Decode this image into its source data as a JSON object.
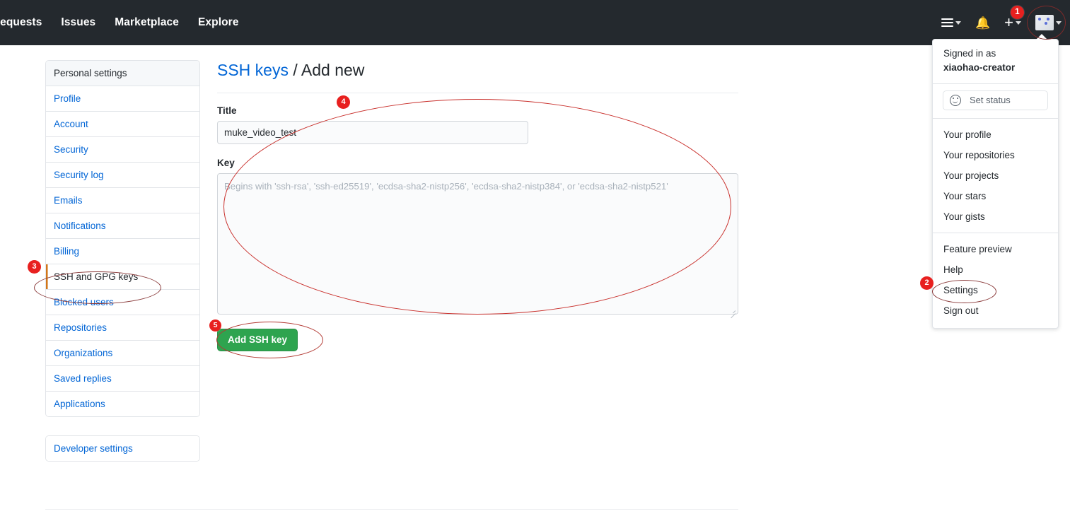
{
  "header": {
    "nav_items": [
      {
        "label": "requests"
      },
      {
        "label": "Issues"
      },
      {
        "label": "Marketplace"
      },
      {
        "label": "Explore"
      }
    ],
    "icons": {
      "hamburger": "hamburger-icon",
      "bell": "bell-icon",
      "plus": "plus-icon",
      "avatar": "avatar-image"
    },
    "notification_badge": "1"
  },
  "user_dropdown": {
    "signed_in_as_label": "Signed in as",
    "username": "xiaohao-creator",
    "set_status_label": "Set status",
    "group_one": [
      {
        "label": "Your profile"
      },
      {
        "label": "Your repositories"
      },
      {
        "label": "Your projects"
      },
      {
        "label": "Your stars"
      },
      {
        "label": "Your gists"
      }
    ],
    "group_two": [
      {
        "label": "Feature preview"
      },
      {
        "label": "Help"
      },
      {
        "label": "Settings"
      },
      {
        "label": "Sign out"
      }
    ]
  },
  "sidebar": {
    "heading": "Personal settings",
    "items": [
      {
        "label": "Profile",
        "selected": false
      },
      {
        "label": "Account",
        "selected": false
      },
      {
        "label": "Security",
        "selected": false
      },
      {
        "label": "Security log",
        "selected": false
      },
      {
        "label": "Emails",
        "selected": false
      },
      {
        "label": "Notifications",
        "selected": false
      },
      {
        "label": "Billing",
        "selected": false
      },
      {
        "label": "SSH and GPG keys",
        "selected": true
      },
      {
        "label": "Blocked users",
        "selected": false
      },
      {
        "label": "Repositories",
        "selected": false
      },
      {
        "label": "Organizations",
        "selected": false
      },
      {
        "label": "Saved replies",
        "selected": false
      },
      {
        "label": "Applications",
        "selected": false
      }
    ],
    "developer_settings_label": "Developer settings"
  },
  "main": {
    "title_link": "SSH keys",
    "title_separator": " / ",
    "title_rest": "Add new",
    "title_label": "Title",
    "title_value": "muke_video_test",
    "key_label": "Key",
    "key_value": "",
    "key_placeholder": "Begins with 'ssh-rsa', 'ssh-ed25519', 'ecdsa-sha2-nistp256', 'ecdsa-sha2-nistp384', or 'ecdsa-sha2-nistp521'",
    "submit_label": "Add SSH key"
  },
  "annotations": {
    "step_1": "1",
    "step_2": "2",
    "step_3": "3",
    "step_4": "4",
    "step_5": "5"
  },
  "colors": {
    "header_bg": "#24292e",
    "link_blue": "#0366d6",
    "button_green": "#2ea44f",
    "badge_red": "#e8201f",
    "annotation_red": "#d93025",
    "selected_border": "#d1761a"
  }
}
